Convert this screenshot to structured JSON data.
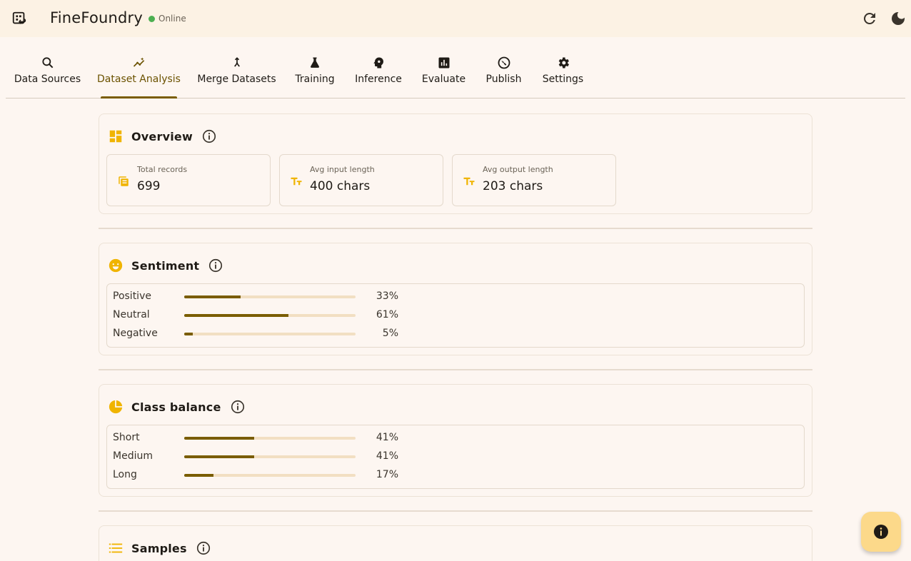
{
  "app": {
    "title": "FineFoundry",
    "status": "Online",
    "status_color": "#4caf50",
    "accent": "#7a5d00",
    "icon_accent": "#f0b400"
  },
  "tabs": [
    {
      "label": "Data Sources",
      "icon": "search-icon"
    },
    {
      "label": "Dataset Analysis",
      "icon": "insights-icon",
      "active": true
    },
    {
      "label": "Merge Datasets",
      "icon": "merge-icon"
    },
    {
      "label": "Training",
      "icon": "flask-icon"
    },
    {
      "label": "Inference",
      "icon": "psychology-icon"
    },
    {
      "label": "Evaluate",
      "icon": "bar-chart-icon"
    },
    {
      "label": "Publish",
      "icon": "publish-icon"
    },
    {
      "label": "Settings",
      "icon": "gear-icon"
    }
  ],
  "overview": {
    "title": "Overview",
    "stats": [
      {
        "label": "Total records",
        "value": "699",
        "icon": "stack-icon"
      },
      {
        "label": "Avg input length",
        "value": "400 chars",
        "icon": "text-size-icon"
      },
      {
        "label": "Avg output length",
        "value": "203 chars",
        "icon": "text-size-icon"
      }
    ]
  },
  "sentiment": {
    "title": "Sentiment",
    "rows": [
      {
        "label": "Positive",
        "pct_text": "33%",
        "value": 0.33
      },
      {
        "label": "Neutral",
        "pct_text": "61%",
        "value": 0.61
      },
      {
        "label": "Negative",
        "pct_text": "5%",
        "value": 0.05
      }
    ]
  },
  "class_balance": {
    "title": "Class balance",
    "rows": [
      {
        "label": "Short",
        "pct_text": "41%",
        "value": 0.41
      },
      {
        "label": "Medium",
        "pct_text": "41%",
        "value": 0.41
      },
      {
        "label": "Long",
        "pct_text": "17%",
        "value": 0.17
      }
    ]
  },
  "samples": {
    "title": "Samples"
  }
}
